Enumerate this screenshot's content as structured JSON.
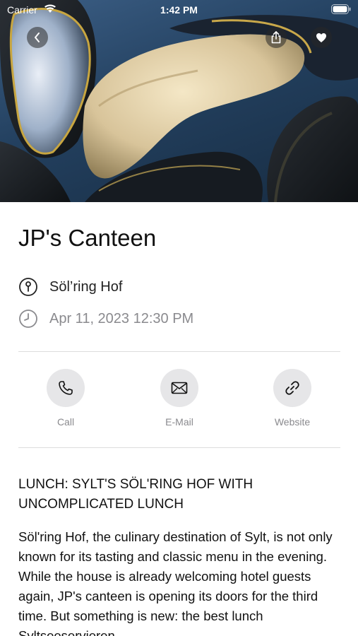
{
  "status_bar": {
    "carrier": "Carrier",
    "time": "1:42 PM"
  },
  "hero": {
    "image_subject": "mussels photo",
    "back_icon": "chevron-left-icon",
    "share_icon": "share-icon",
    "favorite_icon": "heart-icon"
  },
  "event": {
    "title": "JP's Canteen",
    "venue": "Söl’ring Hof",
    "datetime": "Apr 11, 2023 12:30 PM"
  },
  "actions": [
    {
      "label": "Call",
      "icon": "phone-icon"
    },
    {
      "label": "E-Mail",
      "icon": "envelope-icon"
    },
    {
      "label": "Website",
      "icon": "link-icon"
    }
  ],
  "article": {
    "heading": "LUNCH: SYLT'S SÖL'RING HOF WITH UNCOMPLICATED LUNCH",
    "body": "Söl'ring Hof, the culinary destination of Sylt, is not only known for its tasting and classic menu in the evening. While the house is already welcoming hotel guests again, JP's canteen is opening its doors for the third time. But something is new: the best lunch Syltseeservieren"
  },
  "colors": {
    "secondary_text": "#8a8a8e",
    "action_circle": "#e6e6e8",
    "divider": "#dcdcdc",
    "hero_button": "#282828"
  }
}
